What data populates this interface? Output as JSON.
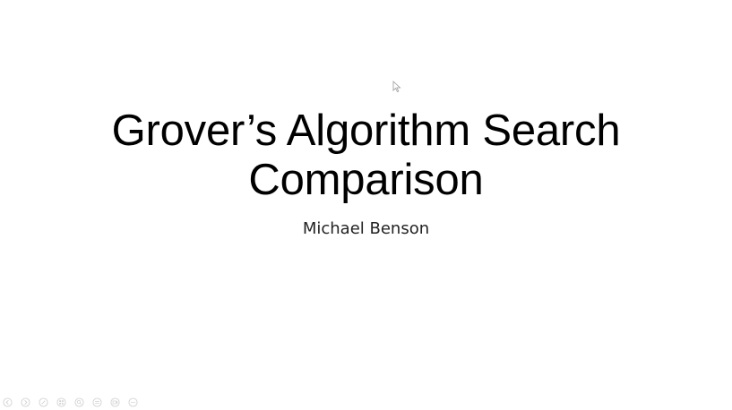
{
  "slide": {
    "title_line1": "Grover’s Algorithm Search",
    "title_line2": "Comparison",
    "subtitle": "Michael Benson"
  },
  "presenter_toolbar": {
    "buttons": [
      {
        "icon": "previous-icon"
      },
      {
        "icon": "next-icon"
      },
      {
        "icon": "pen-icon"
      },
      {
        "icon": "slides-grid-icon"
      },
      {
        "icon": "zoom-icon"
      },
      {
        "icon": "subtitles-icon"
      },
      {
        "icon": "camera-icon"
      },
      {
        "icon": "more-options-icon"
      }
    ]
  },
  "colors": {
    "background": "#ffffff",
    "title_text": "#000000",
    "subtitle_text": "#222222",
    "toolbar_icon": "#808080"
  }
}
